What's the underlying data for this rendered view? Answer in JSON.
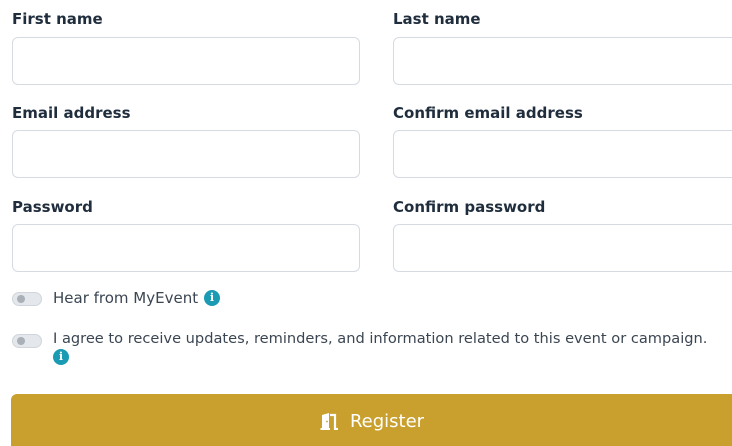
{
  "form": {
    "first_name": {
      "label": "First name",
      "value": "",
      "placeholder": ""
    },
    "last_name": {
      "label": "Last name",
      "value": "",
      "placeholder": ""
    },
    "email": {
      "label": "Email address",
      "value": "",
      "placeholder": ""
    },
    "confirm_email": {
      "label": "Confirm email address",
      "value": "",
      "placeholder": ""
    },
    "password": {
      "label": "Password",
      "value": "",
      "placeholder": ""
    },
    "confirm_password": {
      "label": "Confirm password",
      "value": "",
      "placeholder": ""
    }
  },
  "toggles": [
    {
      "label": "Hear from MyEvent",
      "checked": false,
      "info_icon": "info-icon"
    },
    {
      "label": "I agree to receive updates, reminders, and information related to this event or campaign.",
      "checked": false,
      "info_icon": "info-icon"
    }
  ],
  "info_glyph": "i",
  "register_button": {
    "label": "Register",
    "icon": "door-open-icon"
  },
  "colors": {
    "accent": "#c9a02e",
    "info": "#1a9bb3",
    "border": "#d6dbe1",
    "label_text": "#1f2d3d"
  }
}
